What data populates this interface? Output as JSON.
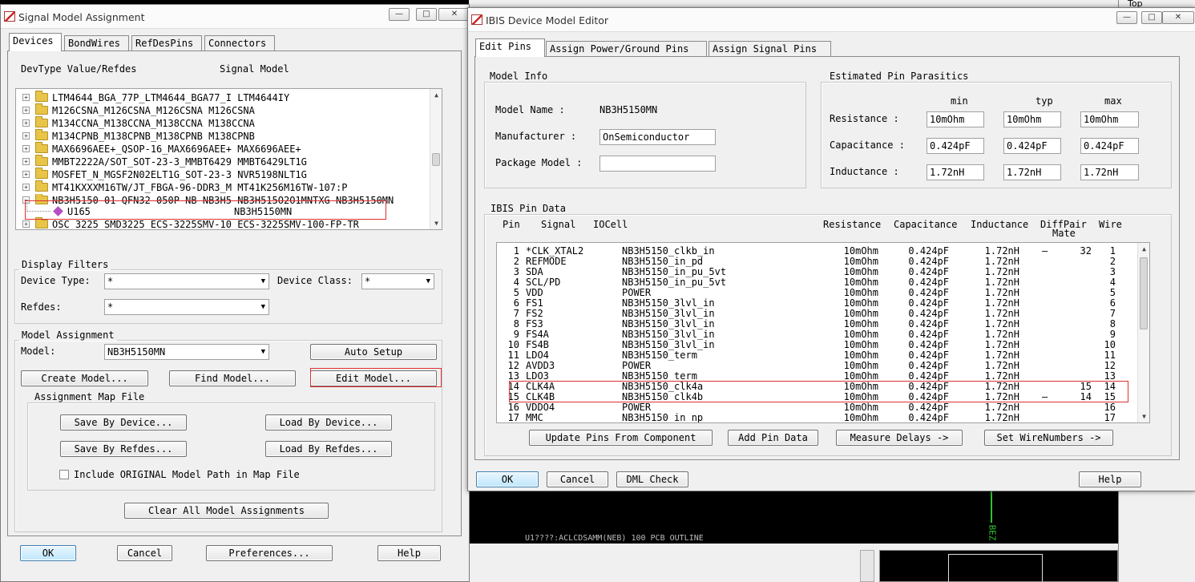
{
  "background": {
    "pcb_bottom_label": "U1????:ACLCDSAMM(NEB) 100 PCB OUTLINE",
    "pcb_right_label": "BEZ",
    "corner_label": "Top"
  },
  "left_window": {
    "title": "Signal Model Assignment",
    "tabs": [
      "Devices",
      "BondWires",
      "RefDesPins",
      "Connectors"
    ],
    "active_tab": "Devices",
    "list_header_left": "DevType Value/Refdes",
    "list_header_right": "Signal Model",
    "device_rows": [
      {
        "label": "LTM4644_BGA_77P_LTM4644_BGA77_I LTM4644IY"
      },
      {
        "label": "M126CSNA_M126CSNA_M126CSNA M126CSNA"
      },
      {
        "label": "M134CCNA_M138CCNA_M138CCNA M138CCNA"
      },
      {
        "label": "M134CPNB_M138CPNB_M138CPNB M138CPNB"
      },
      {
        "label": "MAX6696AEE+_QSOP-16_MAX6696AEE+ MAX6696AEE+"
      },
      {
        "label": "MMBT2222A/SOT_SOT-23-3_MMBT6429 MMBT6429LT1G"
      },
      {
        "label": "MOSFET_N_MGSF2N02ELT1G_SOT-23-3 NVR5198NLT1G"
      },
      {
        "label": "MT41KXXXM16TW/JT_FBGA-96-DDR3_M MT41K256M16TW-107:P"
      },
      {
        "label": "NB3H5150-01_QFN32_050P_NB_NB3H5 NB3H515O2O1MNTXG NB3H5150MN"
      }
    ],
    "child_row": {
      "refdes": "U165",
      "model": "NB3H5150MN"
    },
    "last_row": "OSC_3225_SMD3225_ECS-3225SMV-10 ECS-3225SMV-100-FP-TR",
    "display_filters": {
      "title": "Display Filters",
      "device_type_label": "Device Type:",
      "device_type_value": "*",
      "device_class_label": "Device Class:",
      "device_class_value": "*",
      "refdes_label": "Refdes:",
      "refdes_value": "*"
    },
    "model_assignment": {
      "title": "Model Assignment",
      "model_label": "Model:",
      "model_value": "NB3H5150MN",
      "auto_setup": "Auto Setup",
      "create_model": "Create Model...",
      "find_model": "Find Model...",
      "edit_model": "Edit Model...",
      "map_file_title": "Assignment Map File",
      "save_by_device": "Save By Device...",
      "load_by_device": "Load By Device...",
      "save_by_refdes": "Save By Refdes...",
      "load_by_refdes": "Load By Refdes...",
      "include_original": "Include ORIGINAL Model Path in Map File",
      "clear_all": "Clear All Model Assignments"
    },
    "footer": {
      "ok": "OK",
      "cancel": "Cancel",
      "preferences": "Preferences...",
      "help": "Help"
    }
  },
  "right_window": {
    "title": "IBIS Device Model Editor",
    "tabs": [
      "Edit Pins",
      "Assign Power/Ground Pins",
      "Assign Signal Pins"
    ],
    "active_tab": "Edit Pins",
    "model_info": {
      "title": "Model Info",
      "model_name_label": "Model Name :",
      "model_name_value": "NB3H5150MN",
      "manufacturer_label": "Manufacturer :",
      "manufacturer_value": "OnSemiconductor",
      "package_label": "Package Model :",
      "package_value": ""
    },
    "parasitics": {
      "title": "Estimated Pin Parasitics",
      "col_min": "min",
      "col_typ": "typ",
      "col_max": "max",
      "resistance_label": "Resistance :",
      "capacitance_label": "Capacitance :",
      "inductance_label": "Inductance :",
      "resistance": [
        "10mOhm",
        "10mOhm",
        "10mOhm"
      ],
      "capacitance": [
        "0.424pF",
        "0.424pF",
        "0.424pF"
      ],
      "inductance": [
        "1.72nH",
        "1.72nH",
        "1.72nH"
      ]
    },
    "pin_data": {
      "title": "IBIS Pin Data",
      "headers": {
        "pin": "Pin",
        "signal": "Signal",
        "iocell": "IOCell",
        "resistance": "Resistance",
        "capacitance": "Capacitance",
        "inductance": "Inductance",
        "diffpair": "DiffPair",
        "mate": "Mate",
        "wire": "Wire"
      },
      "rows": [
        {
          "pin": "1",
          "signal": "*CLK_XTAL2",
          "iocell": "NB3H5150_clkb_in",
          "res": "10mOhm",
          "cap": "0.424pF",
          "ind": "1.72nH",
          "diff": "–",
          "mate": "32",
          "wire": "1"
        },
        {
          "pin": "2",
          "signal": "REFMODE",
          "iocell": "NB3H5150_in_pd",
          "res": "10mOhm",
          "cap": "0.424pF",
          "ind": "1.72nH",
          "diff": "",
          "mate": "",
          "wire": "2"
        },
        {
          "pin": "3",
          "signal": "SDA",
          "iocell": "NB3H5150_in_pu_5vt",
          "res": "10mOhm",
          "cap": "0.424pF",
          "ind": "1.72nH",
          "diff": "",
          "mate": "",
          "wire": "3"
        },
        {
          "pin": "4",
          "signal": "SCL/PD",
          "iocell": "NB3H5150_in_pu_5vt",
          "res": "10mOhm",
          "cap": "0.424pF",
          "ind": "1.72nH",
          "diff": "",
          "mate": "",
          "wire": "4"
        },
        {
          "pin": "5",
          "signal": "VDD",
          "iocell": "POWER",
          "res": "10mOhm",
          "cap": "0.424pF",
          "ind": "1.72nH",
          "diff": "",
          "mate": "",
          "wire": "5"
        },
        {
          "pin": "6",
          "signal": "FS1",
          "iocell": "NB3H5150_3lvl_in",
          "res": "10mOhm",
          "cap": "0.424pF",
          "ind": "1.72nH",
          "diff": "",
          "mate": "",
          "wire": "6"
        },
        {
          "pin": "7",
          "signal": "FS2",
          "iocell": "NB3H5150_3lvl_in",
          "res": "10mOhm",
          "cap": "0.424pF",
          "ind": "1.72nH",
          "diff": "",
          "mate": "",
          "wire": "7"
        },
        {
          "pin": "8",
          "signal": "FS3",
          "iocell": "NB3H5150_3lvl_in",
          "res": "10mOhm",
          "cap": "0.424pF",
          "ind": "1.72nH",
          "diff": "",
          "mate": "",
          "wire": "8"
        },
        {
          "pin": "9",
          "signal": "FS4A",
          "iocell": "NB3H5150_3lvl_in",
          "res": "10mOhm",
          "cap": "0.424pF",
          "ind": "1.72nH",
          "diff": "",
          "mate": "",
          "wire": "9"
        },
        {
          "pin": "10",
          "signal": "FS4B",
          "iocell": "NB3H5150_3lvl_in",
          "res": "10mOhm",
          "cap": "0.424pF",
          "ind": "1.72nH",
          "diff": "",
          "mate": "",
          "wire": "10"
        },
        {
          "pin": "11",
          "signal": "LDO4",
          "iocell": "NB3H5150_term",
          "res": "10mOhm",
          "cap": "0.424pF",
          "ind": "1.72nH",
          "diff": "",
          "mate": "",
          "wire": "11"
        },
        {
          "pin": "12",
          "signal": "AVDD3",
          "iocell": "POWER",
          "res": "10mOhm",
          "cap": "0.424pF",
          "ind": "1.72nH",
          "diff": "",
          "mate": "",
          "wire": "12"
        },
        {
          "pin": "13",
          "signal": "LDO3",
          "iocell": "NB3H5150_term",
          "res": "10mOhm",
          "cap": "0.424pF",
          "ind": "1.72nH",
          "diff": "",
          "mate": "",
          "wire": "13"
        },
        {
          "pin": "14",
          "signal": "CLK4A",
          "iocell": "NB3H5150_clk4a",
          "res": "10mOhm",
          "cap": "0.424pF",
          "ind": "1.72nH",
          "diff": "",
          "mate": "15",
          "wire": "14"
        },
        {
          "pin": "15",
          "signal": "CLK4B",
          "iocell": "NB3H5150_clk4b",
          "res": "10mOhm",
          "cap": "0.424pF",
          "ind": "1.72nH",
          "diff": "–",
          "mate": "14",
          "wire": "15"
        },
        {
          "pin": "16",
          "signal": "VDDO4",
          "iocell": "POWER",
          "res": "10mOhm",
          "cap": "0.424pF",
          "ind": "1.72nH",
          "diff": "",
          "mate": "",
          "wire": "16"
        },
        {
          "pin": "17",
          "signal": "MMC",
          "iocell": "NB3H5150_in_np",
          "res": "10mOhm",
          "cap": "0.424pF",
          "ind": "1.72nH",
          "diff": "",
          "mate": "",
          "wire": "17"
        }
      ],
      "update_pins": "Update Pins From Component",
      "add_pin_data": "Add Pin Data",
      "measure_delays": "Measure Delays ->",
      "set_wirenumbers": "Set WireNumbers ->"
    },
    "footer": {
      "ok": "OK",
      "cancel": "Cancel",
      "dml_check": "DML Check",
      "help": "Help"
    }
  }
}
